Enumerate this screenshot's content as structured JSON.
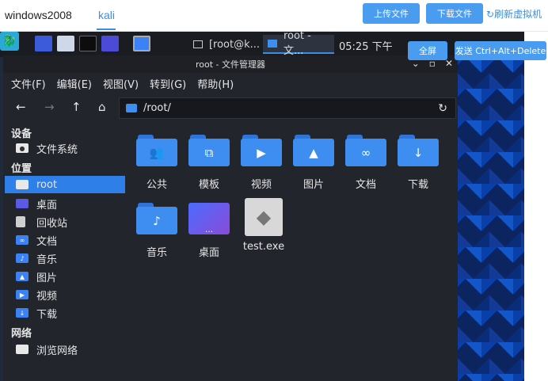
{
  "topbar": {
    "tabs": [
      {
        "label": "windows2008"
      },
      {
        "label": "kali"
      }
    ],
    "upload_label": "上传文件",
    "download_label": "下载文件",
    "refresh_label": "刷新虚拟机"
  },
  "overlay": {
    "fullscreen_label": "全屏",
    "send_cad_label": "发送 Ctrl+Alt+Delete"
  },
  "panel": {
    "task1_label": "[root@k...",
    "task2_label": "root - 文...",
    "clock": "05:25 下午"
  },
  "window": {
    "title": "root - 文件管理器",
    "menu": [
      "文件(F)",
      "编辑(E)",
      "视图(V)",
      "转到(G)",
      "帮助(H)"
    ],
    "path": "/root/"
  },
  "sidebar": {
    "devices_head": "设备",
    "places_head": "位置",
    "network_head": "网络",
    "devices": [
      {
        "label": "文件系统"
      }
    ],
    "places": [
      {
        "label": "root"
      },
      {
        "label": "桌面"
      },
      {
        "label": "回收站"
      },
      {
        "label": "文档"
      },
      {
        "label": "音乐"
      },
      {
        "label": "图片"
      },
      {
        "label": "视频"
      },
      {
        "label": "下载"
      }
    ],
    "network": [
      {
        "label": "浏览网络"
      }
    ]
  },
  "files": [
    {
      "label": "公共",
      "icon": "people-icon"
    },
    {
      "label": "模板",
      "icon": "template-icon"
    },
    {
      "label": "视频",
      "icon": "video-icon"
    },
    {
      "label": "图片",
      "icon": "image-icon"
    },
    {
      "label": "文档",
      "icon": "attachment-icon"
    },
    {
      "label": "下载",
      "icon": "download-icon"
    },
    {
      "label": "音乐",
      "icon": "music-icon"
    },
    {
      "label": "桌面",
      "icon": "desktop-icon"
    },
    {
      "label": "test.exe",
      "icon": "exe-icon"
    }
  ]
}
